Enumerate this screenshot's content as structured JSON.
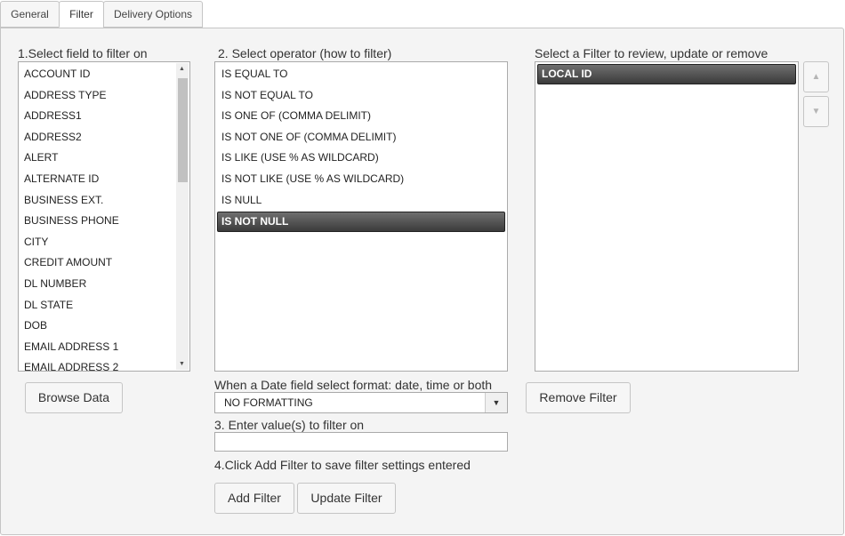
{
  "tabs": [
    {
      "label": "General",
      "active": false
    },
    {
      "label": "Filter",
      "active": true
    },
    {
      "label": "Delivery Options",
      "active": false
    }
  ],
  "fields": {
    "label": "1.Select field to filter on",
    "items": [
      "ACCOUNT ID",
      "ADDRESS TYPE",
      "ADDRESS1",
      "ADDRESS2",
      "ALERT",
      "ALTERNATE ID",
      "BUSINESS EXT.",
      "BUSINESS PHONE",
      "CITY",
      "CREDIT AMOUNT",
      "DL NUMBER",
      "DL STATE",
      "DOB",
      "EMAIL ADDRESS 1",
      "EMAIL ADDRESS 2"
    ],
    "browse_label": "Browse Data"
  },
  "operators": {
    "label": "2. Select operator (how to filter)",
    "items": [
      "IS EQUAL TO",
      "IS NOT EQUAL TO",
      "IS ONE OF (COMMA DELIMIT)",
      "IS NOT ONE OF (COMMA DELIMIT)",
      "IS LIKE (USE % AS WILDCARD)",
      "IS NOT LIKE (USE % AS WILDCARD)",
      "IS NULL",
      "IS NOT NULL"
    ],
    "selected": "IS NOT NULL"
  },
  "date_format": {
    "label": "When a Date field select format: date, time or both",
    "value": "NO FORMATTING"
  },
  "value_entry": {
    "label": "3. Enter value(s) to filter on",
    "value": ""
  },
  "instruction": "4.Click Add Filter to save filter settings entered",
  "buttons": {
    "add": "Add Filter",
    "update": "Update Filter",
    "remove": "Remove Filter"
  },
  "filters": {
    "label": "Select a Filter to review, update or remove",
    "items": [
      "LOCAL ID"
    ],
    "selected": "LOCAL ID"
  }
}
